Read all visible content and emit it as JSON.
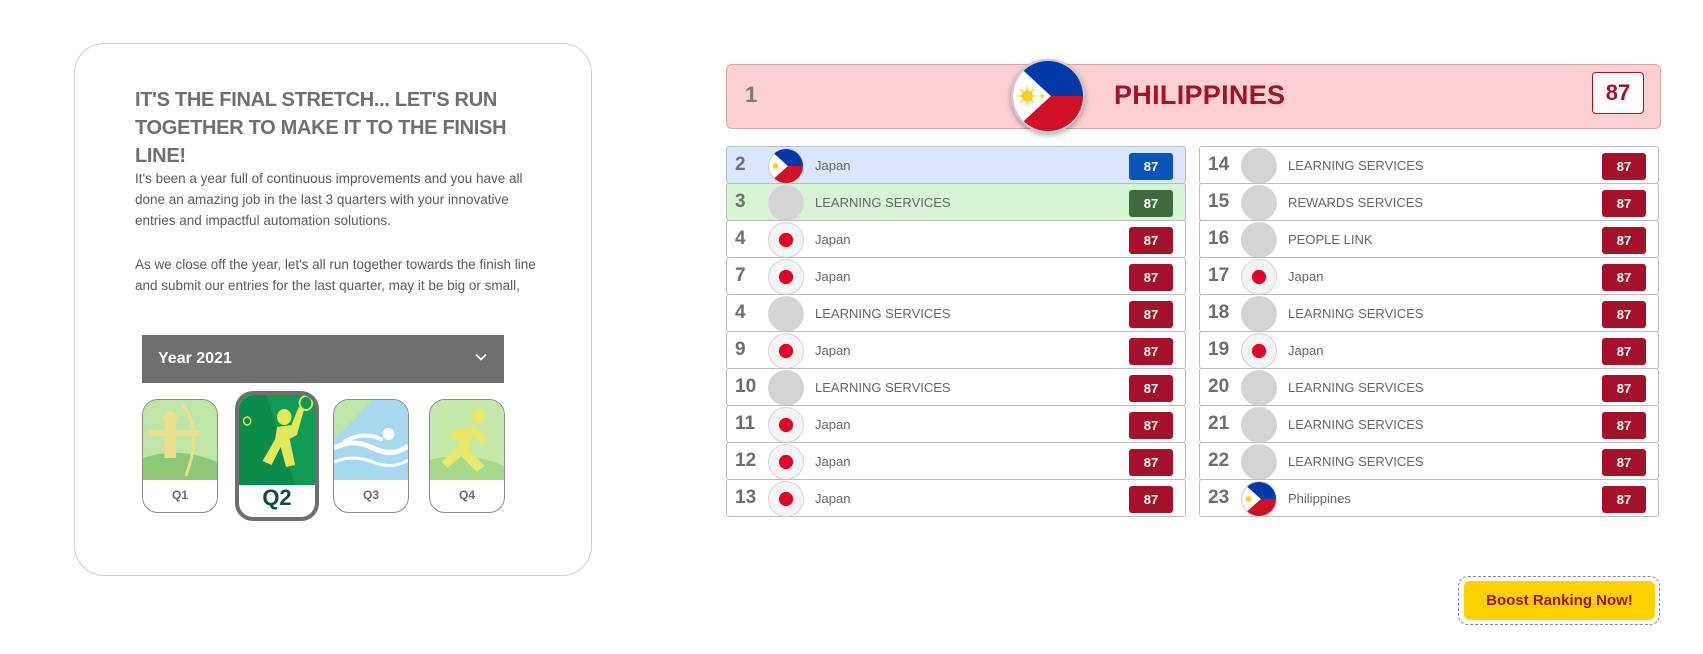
{
  "intro": {
    "heading": "IT'S THE FINAL STRETCH... LET'S RUN TOGETHER TO MAKE IT TO THE FINISH LINE!",
    "paragraph1": "It's been a year full of continuous improvements and you have all done an amazing job in the last 3 quarters with your innovative entries and impactful automation solutions.",
    "paragraph2": "As we close off the year, let's all run together towards the finish line and submit our entries for the last quarter, may it be big or small, any"
  },
  "year_select": {
    "label": "Year 2021"
  },
  "quarters": [
    {
      "label": "Q1",
      "icon": "archery-icon",
      "selected": false
    },
    {
      "label": "Q2",
      "icon": "badminton-icon",
      "selected": true
    },
    {
      "label": "Q3",
      "icon": "swimming-icon",
      "selected": false
    },
    {
      "label": "Q4",
      "icon": "running-icon",
      "selected": false
    }
  ],
  "leader": {
    "rank": "1",
    "name": "PHILIPPINES",
    "score": "87",
    "flag": "philippines-flag-icon"
  },
  "left_rows": [
    {
      "rank": "2",
      "name": "Japan",
      "score": "87",
      "avatar": "philippines-flag-icon",
      "style": "blue"
    },
    {
      "rank": "3",
      "name": "LEARNING SERVICES",
      "score": "87",
      "avatar": "placeholder",
      "style": "green"
    },
    {
      "rank": "4",
      "name": "Japan",
      "score": "87",
      "avatar": "japan-flag-icon",
      "style": ""
    },
    {
      "rank": "7",
      "name": "Japan",
      "score": "87",
      "avatar": "japan-flag-icon",
      "style": ""
    },
    {
      "rank": "4",
      "name": "LEARNING SERVICES",
      "score": "87",
      "avatar": "placeholder",
      "style": ""
    },
    {
      "rank": "9",
      "name": "Japan",
      "score": "87",
      "avatar": "japan-flag-icon",
      "style": ""
    },
    {
      "rank": "10",
      "name": "LEARNING SERVICES",
      "score": "87",
      "avatar": "placeholder",
      "style": ""
    },
    {
      "rank": "11",
      "name": "Japan",
      "score": "87",
      "avatar": "japan-flag-icon",
      "style": ""
    },
    {
      "rank": "12",
      "name": "Japan",
      "score": "87",
      "avatar": "japan-flag-icon",
      "style": ""
    },
    {
      "rank": "13",
      "name": "Japan",
      "score": "87",
      "avatar": "japan-flag-icon",
      "style": ""
    }
  ],
  "right_rows": [
    {
      "rank": "14",
      "name": "LEARNING SERVICES",
      "score": "87",
      "avatar": "placeholder",
      "style": ""
    },
    {
      "rank": "15",
      "name": "REWARDS SERVICES",
      "score": "87",
      "avatar": "placeholder",
      "style": ""
    },
    {
      "rank": "16",
      "name": "PEOPLE LINK",
      "score": "87",
      "avatar": "placeholder",
      "style": ""
    },
    {
      "rank": "17",
      "name": "Japan",
      "score": "87",
      "avatar": "japan-flag-icon",
      "style": ""
    },
    {
      "rank": "18",
      "name": "LEARNING SERVICES",
      "score": "87",
      "avatar": "placeholder",
      "style": ""
    },
    {
      "rank": "19",
      "name": "Japan",
      "score": "87",
      "avatar": "japan-flag-icon",
      "style": ""
    },
    {
      "rank": "20",
      "name": "LEARNING SERVICES",
      "score": "87",
      "avatar": "placeholder",
      "style": ""
    },
    {
      "rank": "21",
      "name": "LEARNING SERVICES",
      "score": "87",
      "avatar": "placeholder",
      "style": ""
    },
    {
      "rank": "22",
      "name": "LEARNING SERVICES",
      "score": "87",
      "avatar": "placeholder",
      "style": ""
    },
    {
      "rank": "23",
      "name": "Philippines",
      "score": "87",
      "avatar": "philippines-flag-icon",
      "style": ""
    }
  ],
  "boost_button": {
    "label": "Boost Ranking Now!"
  },
  "colors": {
    "accent_red": "#a4122a",
    "leader_bg": "#fdd1d2",
    "rank2_bg": "#d9e6fb",
    "rank2_badge": "#0a54b8",
    "rank3_bg": "#d7f5d5",
    "rank3_badge": "#3f6a3f",
    "boost_bg": "#ffd100",
    "select_bg": "#6f6f6f"
  }
}
